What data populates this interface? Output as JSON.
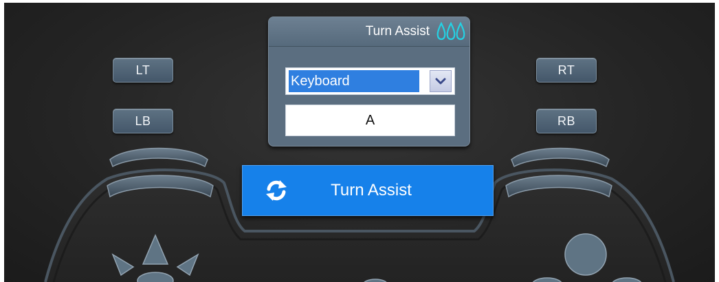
{
  "controller": {
    "lt_label": "LT",
    "lb_label": "LB",
    "rt_label": "RT",
    "rb_label": "RB"
  },
  "panel": {
    "title": "Turn Assist",
    "title_icon": "water-drops-icon",
    "input_type_selected": "Keyboard",
    "key_value": "A"
  },
  "action_button": {
    "label": "Turn Assist",
    "icon": "refresh-icon"
  },
  "colors": {
    "accent_blue": "#1681ea",
    "panel_slate": "#5b6e80",
    "drops_cyan": "#24d2e4"
  }
}
